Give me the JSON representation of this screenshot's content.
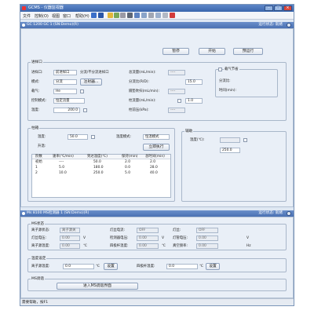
{
  "window": {
    "title": "GCMS - 仪器监视器"
  },
  "menu": [
    "文件",
    "控制(O)",
    "视图",
    "窗口",
    "帮助(H)"
  ],
  "gc_section": {
    "title": "GC 1200 GC  1 (SN:Demo)(R)",
    "status": "运行状态: 就绪"
  },
  "actions": {
    "stop": "暂停",
    "start": "开始",
    "prerun": "预运行"
  },
  "inlet": {
    "title": "进样口",
    "port_label": "进样口:",
    "port_value": "前进样口",
    "mode_label": "模式:",
    "mode_value": "分流",
    "split_note": "分流/不分流进样口",
    "setup": "注射器...",
    "gas_label": "载气:",
    "gas_value": "He",
    "control_label": "控制模式:",
    "control_value": "恒定流量",
    "temp_label": "温度:",
    "temp_value": "200.0",
    "total_flow_label": "总流量(mL/min):",
    "total_flow_value": "----",
    "split_ratio_label": "分流比(R/D):",
    "split_ratio_value": "15.0",
    "purge_label": "隔垫吹扫(mL/min):",
    "purge_value": "----",
    "col_flow_label": "柱流量(mL/min):",
    "col_flow_value": "1.0",
    "col_press_label": "柱前压(kPa):",
    "col_press_value": "----",
    "carrier_saver": "载气节省",
    "saver_ratio_label": "分流比:",
    "saver_time_label": "时间(min):"
  },
  "column": {
    "title": "柱箱",
    "temp_label": "温度:",
    "temp_value": "50.0",
    "mode_label": "温度模式:",
    "mode_value": "恒温模式",
    "program_label": "升温:",
    "run_button": "立即执行",
    "headers": [
      "阶数",
      "速率(℃/min)",
      "到达温度(℃)",
      "保持(min)",
      "总时间(min)"
    ],
    "rows": [
      [
        "初始",
        "----",
        "50.0",
        "2.0",
        "2.0"
      ],
      [
        "1",
        "5.0",
        "180.0",
        "0.0",
        "28.0"
      ],
      [
        "2",
        "10.0",
        "250.0",
        "5.0",
        "40.0"
      ]
    ]
  },
  "aux": {
    "title": "辅助",
    "temp_label": "温度(℃):",
    "temp_value": "250.0"
  },
  "ms_section": {
    "title": "Ms 8100 MS检测器 1 (SN:Demo)(R)",
    "status": "运行状态: 就绪"
  },
  "ms_status": {
    "title": "MS状态",
    "source_label": "离子源状态:",
    "source_value": "离子源关",
    "filament_label": "灯丝电流:",
    "filament_value": "OFF",
    "light_label": "灯丝:",
    "light_value": "OFF",
    "lens_label": "灯丝电压:",
    "lens_value": "0.00",
    "lens_unit": "V",
    "detector_label": "检测器电压:",
    "detector_value": "0.00",
    "detector_unit": "V",
    "mult_label": "灯管电压:",
    "mult_value": "0.00",
    "mult_unit": "V",
    "ion_label": "离子源温度:",
    "ion_value": "0.00",
    "ion_unit": "℃",
    "quad_label": "四极杆温度:",
    "quad_value": "0.00",
    "quad_unit": "℃",
    "vac_label": "真空频率:",
    "vac_value": "0.00",
    "vac_unit": "Hz"
  },
  "temp_set": {
    "title": "温度设定",
    "source_label": "离子源温度:",
    "source_value": "0.0",
    "source_unit": "℃",
    "set1": "设置",
    "quad_label": "四极杆温度:",
    "quad_value": "0.0",
    "quad_unit": "℃",
    "set2": "设置"
  },
  "ms_tune": {
    "title": "MS调谐",
    "button": "进入MS调谐界面"
  },
  "statusbar": {
    "text": "需要帮助，按F1"
  }
}
